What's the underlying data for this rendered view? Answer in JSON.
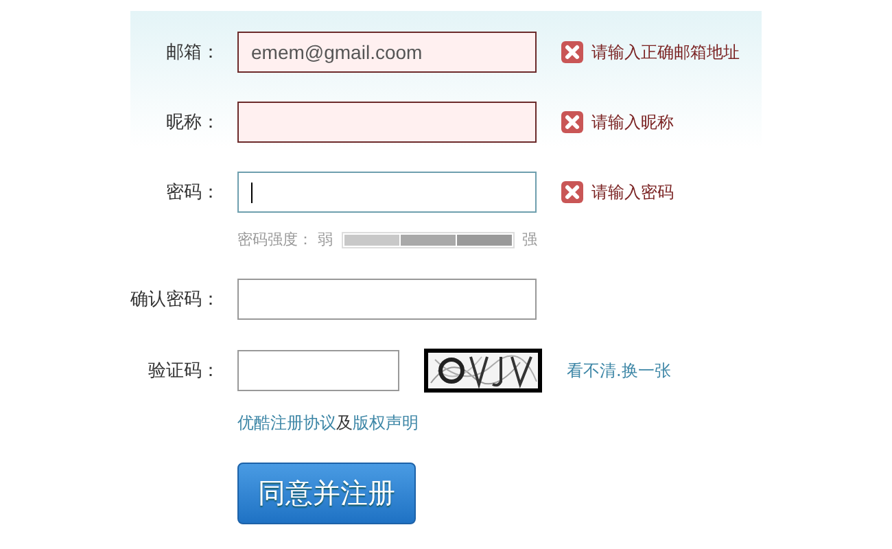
{
  "fields": [
    {
      "label": "邮箱：",
      "kind": "text",
      "invalid": true,
      "focused": false,
      "value": "emem@gmail.coom",
      "message": "请输入正确邮箱地址"
    },
    {
      "label": "昵称：",
      "kind": "text",
      "invalid": true,
      "focused": false,
      "message": "请输入昵称"
    },
    {
      "label": "密码：",
      "kind": "text",
      "invalid": false,
      "focused": true,
      "message": "请输入密码",
      "strength": {
        "label": "密码强度：",
        "weak": "弱",
        "strong": "强"
      }
    },
    {
      "label": "确认密码：",
      "kind": "text",
      "invalid": false,
      "focused": false
    },
    {
      "label": "验证码：",
      "kind": "captcha",
      "invalid": false,
      "focused": false,
      "refresh": "看不清.换一张"
    }
  ],
  "agreement": [
    {
      "kind": "link",
      "text": "优酷注册协议"
    },
    {
      "kind": "text",
      "text": "及"
    },
    {
      "kind": "link",
      "text": "版权声明"
    }
  ],
  "submit": "同意并注册"
}
